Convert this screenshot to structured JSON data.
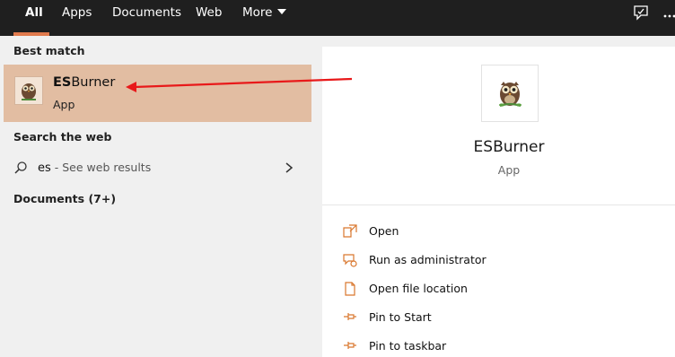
{
  "tabs": {
    "all": "All",
    "apps": "Apps",
    "documents": "Documents",
    "web": "Web",
    "more": "More"
  },
  "best_match": {
    "heading": "Best match",
    "name_bold": "ES",
    "name_rest": "Burner",
    "type": "App"
  },
  "search_web": {
    "heading": "Search the web",
    "query": "es",
    "hint": " - See web results"
  },
  "documents_heading": "Documents (7+)",
  "preview": {
    "title": "ESBurner",
    "type": "App",
    "actions": [
      {
        "label": "Open",
        "icon": "open-icon"
      },
      {
        "label": "Run as administrator",
        "icon": "shield-icon"
      },
      {
        "label": "Open file location",
        "icon": "file-location-icon"
      },
      {
        "label": "Pin to Start",
        "icon": "pin-icon"
      },
      {
        "label": "Pin to taskbar",
        "icon": "pin-icon"
      }
    ]
  },
  "colors": {
    "accent": "#e07a4d",
    "selected_background": "#e2bda2",
    "annotation_arrow": "#e8191a"
  }
}
